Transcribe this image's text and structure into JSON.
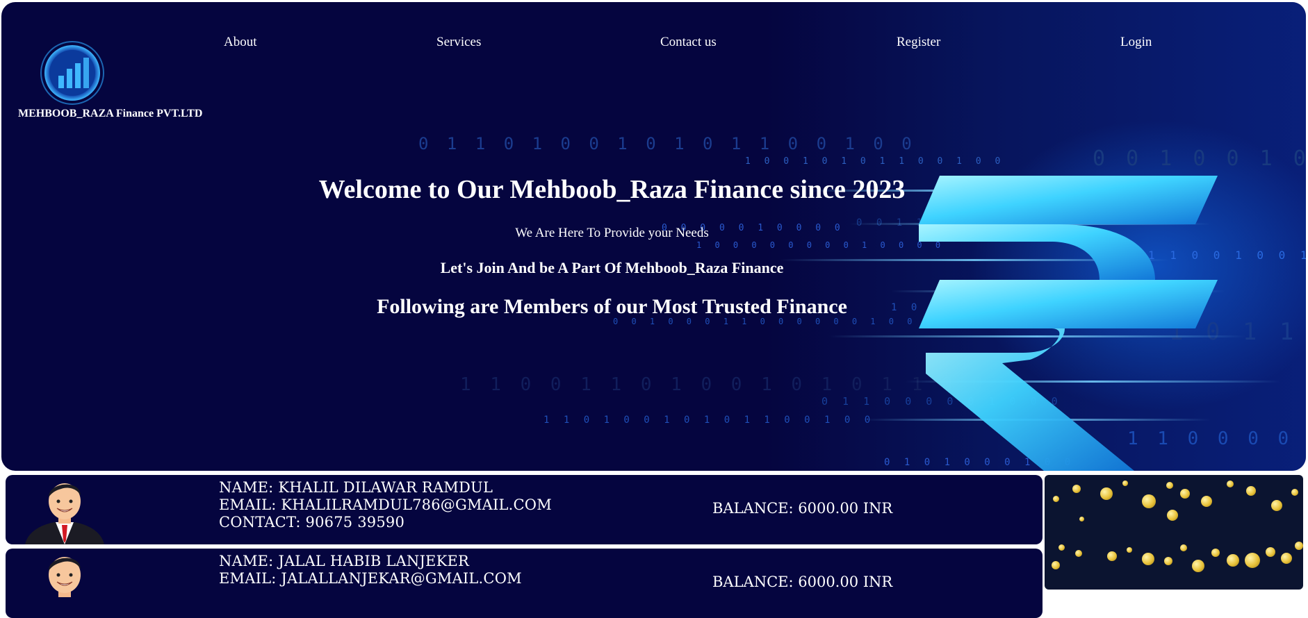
{
  "brand": {
    "company_name": "MEHBOOB_RAZA Finance PVT.LTD",
    "logo_icon": "bar-chart-logo-icon"
  },
  "nav": {
    "items": [
      {
        "label": "About"
      },
      {
        "label": "Services"
      },
      {
        "label": "Contact us"
      },
      {
        "label": "Register"
      },
      {
        "label": "Login"
      }
    ]
  },
  "hero": {
    "title": "Welcome to Our Mehboob_Raza Finance since 2023",
    "subtitle": "We Are Here To Provide your Needs",
    "join_text": "Let's Join And be A Part Of Mehboob_Raza Finance",
    "members_heading": "Following are Members of our Most Trusted Finance",
    "background_icon": "rupee-symbol-icon"
  },
  "members": [
    {
      "name_line": "Name: Khalil Dilawar Ramdul",
      "email_line": "Email: khalilramdul786@gmail.com",
      "contact_line": "Contact: 90675 39590",
      "balance_line": "Balance: 6000.00 INR"
    },
    {
      "name_line": "Name: Jalal Habib Lanjeker",
      "email_line": "Email: jalallanjekar@gmail.com",
      "contact_line": "",
      "balance_line": "Balance: 6000.00 INR"
    }
  ],
  "colors": {
    "hero_bg": "#05053f",
    "card_bg": "#05053f",
    "accent": "#3fd3ff",
    "coin": "#e8c23a"
  }
}
